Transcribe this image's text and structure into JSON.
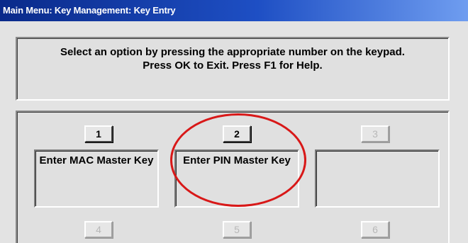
{
  "window": {
    "title": "Main Menu: Key Management: Key Entry"
  },
  "message": {
    "line1": "Select an option by pressing the appropriate number on the keypad.",
    "line2": "Press OK to Exit.  Press F1 for Help."
  },
  "options_row1": [
    {
      "key": "1",
      "label": "Enter MAC Master Key",
      "enabled": true
    },
    {
      "key": "2",
      "label": "Enter PIN Master Key",
      "enabled": true
    },
    {
      "key": "3",
      "label": "",
      "enabled": false
    }
  ],
  "options_row2_keys": [
    "4",
    "5",
    "6"
  ],
  "annotation": {
    "type": "highlight-circle",
    "color": "#d81818"
  }
}
